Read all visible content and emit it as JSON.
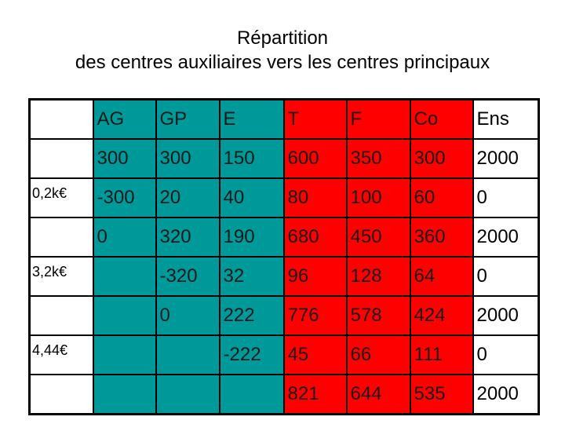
{
  "title": {
    "line1": "Répartition",
    "line2": "des centres auxiliaires vers les centres principaux"
  },
  "colors": {
    "auxiliary": "#009999",
    "principal": "#ff0000",
    "total": "#ffffff"
  },
  "table": {
    "headers": [
      "",
      "AG",
      "GP",
      "E",
      "T",
      "F",
      "Co",
      "Ens"
    ],
    "rows": [
      [
        "",
        "300",
        "300",
        "150",
        "600",
        "350",
        "300",
        "2000"
      ],
      [
        "0,2k€",
        "-300",
        "20",
        "40",
        "80",
        "100",
        "60",
        "0"
      ],
      [
        "",
        "0",
        "320",
        "190",
        "680",
        "450",
        "360",
        "2000"
      ],
      [
        "3,2k€",
        "",
        "-320",
        "32",
        "96",
        "128",
        "64",
        "0"
      ],
      [
        "",
        "",
        "0",
        "222",
        "776",
        "578",
        "424",
        "2000"
      ],
      [
        "4,44€",
        "",
        "",
        "-222",
        "45",
        "66",
        "111",
        "0"
      ],
      [
        "",
        "",
        "",
        "",
        "821",
        "644",
        "535",
        "2000"
      ]
    ]
  }
}
